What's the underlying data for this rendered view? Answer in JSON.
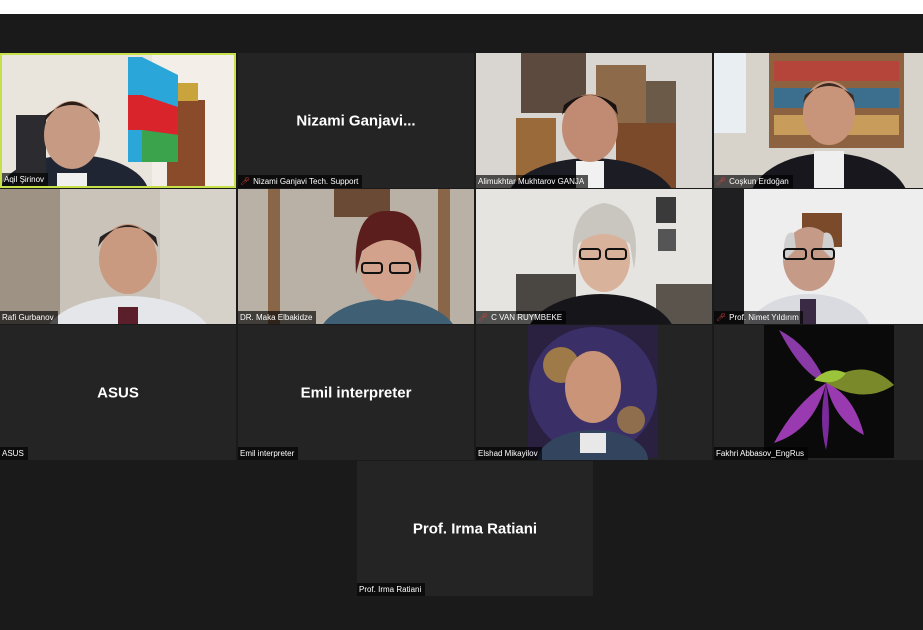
{
  "colors": {
    "background": "#1a1a1a",
    "tile": "#242424",
    "active_speaker_border": "#c6e04a",
    "muted_icon": "#e0413a"
  },
  "participants": [
    {
      "name": "Aqil Şirinov",
      "muted": false,
      "active_speaker": true
    },
    {
      "name": "Nizami Ganjavi Tech. Support",
      "display_name": "Nizami  Ganjavi...",
      "muted": true
    },
    {
      "name": "Alimukhtar Mukhtarov GANJA",
      "muted": false
    },
    {
      "name": "Coşkun Erdoğan",
      "muted": true
    },
    {
      "name": "Rafi Gurbanov",
      "muted": false
    },
    {
      "name": "DR. Maka Elbakidze",
      "muted": false
    },
    {
      "name": "C VAN RUYMBEKE",
      "muted": true
    },
    {
      "name": "Prof. Nimet Yıldırım",
      "muted": true
    },
    {
      "name": "ASUS",
      "display_name": "ASUS",
      "muted": false
    },
    {
      "name": "Emil interpreter",
      "display_name": "Emil interpreter",
      "muted": false
    },
    {
      "name": "Elshad Mikayilov",
      "muted": false
    },
    {
      "name": "Fakhri Abbasov_EngRus",
      "muted": false
    },
    {
      "name": "Prof. Irma Ratiani",
      "display_name": "Prof. Irma Ratiani",
      "muted": false
    }
  ],
  "icons": {
    "muted": "microphone-muted-icon"
  }
}
